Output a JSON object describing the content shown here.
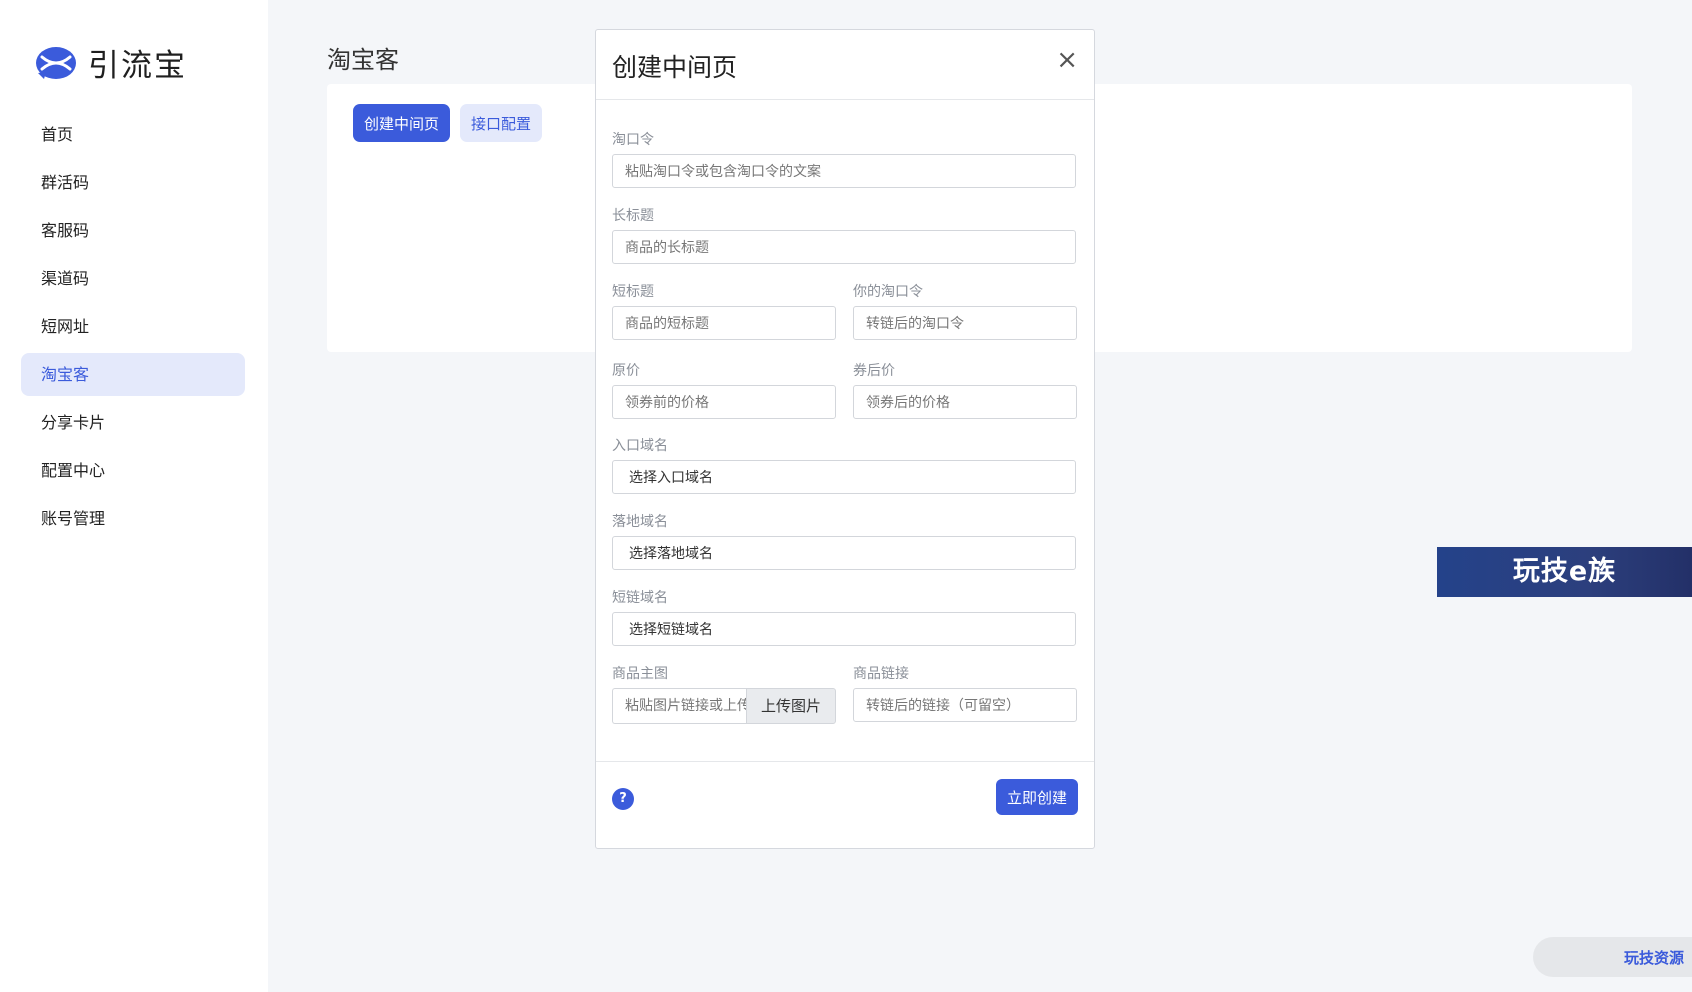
{
  "app": {
    "name": "引流宝",
    "colors": {
      "accent": "#3b5bdb",
      "accent_light": "#e4e9fb"
    }
  },
  "sidebar": {
    "items": [
      {
        "label": "首页",
        "active": false
      },
      {
        "label": "群活码",
        "active": false
      },
      {
        "label": "客服码",
        "active": false
      },
      {
        "label": "渠道码",
        "active": false
      },
      {
        "label": "短网址",
        "active": false
      },
      {
        "label": "淘宝客",
        "active": true
      },
      {
        "label": "分享卡片",
        "active": false
      },
      {
        "label": "配置中心",
        "active": false
      },
      {
        "label": "账号管理",
        "active": false
      }
    ]
  },
  "main": {
    "title": "淘宝客",
    "buttons": {
      "create": "创建中间页",
      "api_config": "接口配置"
    }
  },
  "modal": {
    "title": "创建中间页",
    "close": "×",
    "fields": {
      "taokouling": {
        "label": "淘口令",
        "placeholder": "粘贴淘口令或包含淘口令的文案"
      },
      "long_title": {
        "label": "长标题",
        "placeholder": "商品的长标题"
      },
      "short_title": {
        "label": "短标题",
        "placeholder": "商品的短标题"
      },
      "your_taokouling": {
        "label": "你的淘口令",
        "placeholder": "转链后的淘口令"
      },
      "original_price": {
        "label": "原价",
        "placeholder": "领券前的价格"
      },
      "coupon_price": {
        "label": "券后价",
        "placeholder": "领券后的价格"
      },
      "entry_domain": {
        "label": "入口域名",
        "value": "选择入口域名"
      },
      "landing_domain": {
        "label": "落地域名",
        "value": "选择落地域名"
      },
      "short_domain": {
        "label": "短链域名",
        "value": "选择短链域名"
      },
      "main_image": {
        "label": "商品主图",
        "placeholder": "粘贴图片链接或上传",
        "upload_label": "上传图片"
      },
      "product_link": {
        "label": "商品链接",
        "placeholder": "转链后的链接（可留空）"
      }
    },
    "footer": {
      "help": "?",
      "submit": "立即创建"
    }
  },
  "overlays": {
    "banner": "玩技e族",
    "bottom_badge": "玩技资源"
  }
}
